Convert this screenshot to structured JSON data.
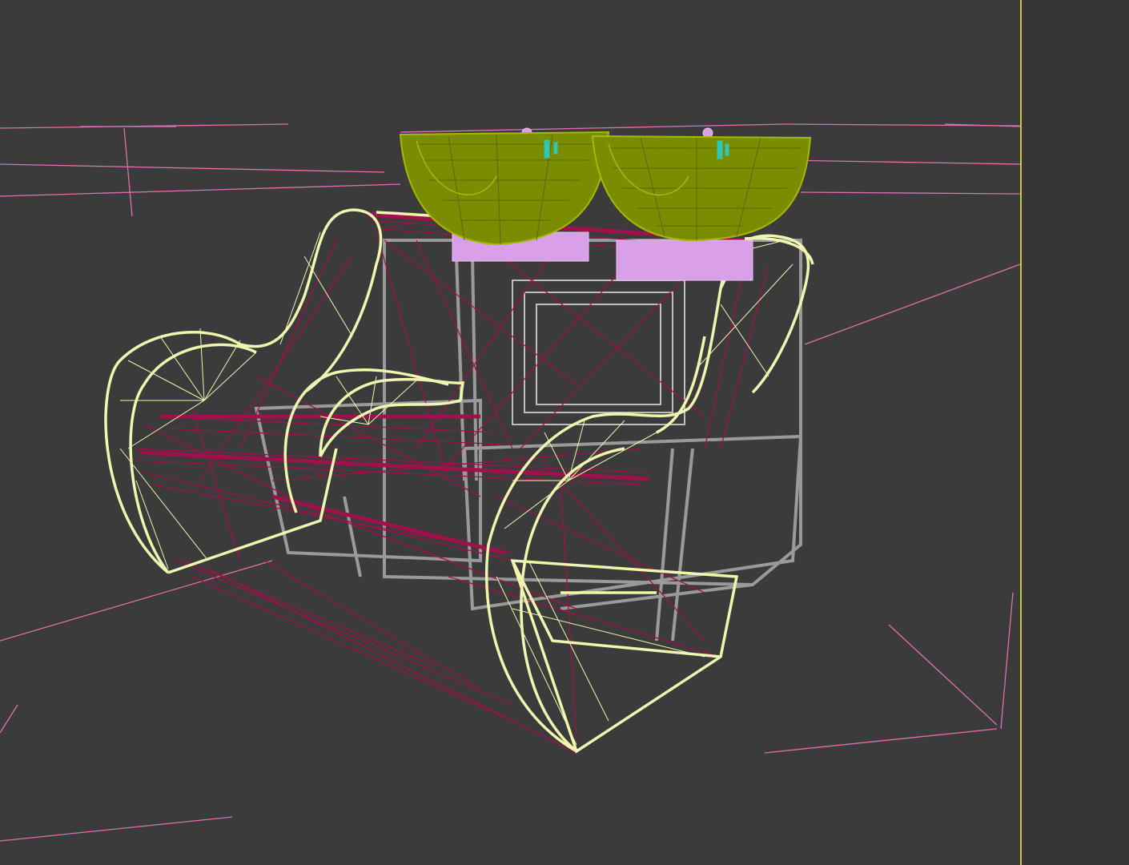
{
  "viewport": {
    "view_mode": "wireframe",
    "background_color": "#3b3b3b",
    "active_border_color": "#c8c84a",
    "objects": [
      {
        "name": "armchair-body-edges",
        "color": "#f0f5b0"
      },
      {
        "name": "armchair-inner-mesh",
        "color": "#a0104a"
      },
      {
        "name": "support-frame",
        "color": "#9a9a9a"
      },
      {
        "name": "wash-basin-bowls",
        "color": "#7a8c00"
      },
      {
        "name": "basin-fittings",
        "color": "#d8a0e8"
      },
      {
        "name": "faucets",
        "color": "#30c8b0"
      },
      {
        "name": "scene-guides",
        "color": "#e070b0"
      }
    ]
  }
}
